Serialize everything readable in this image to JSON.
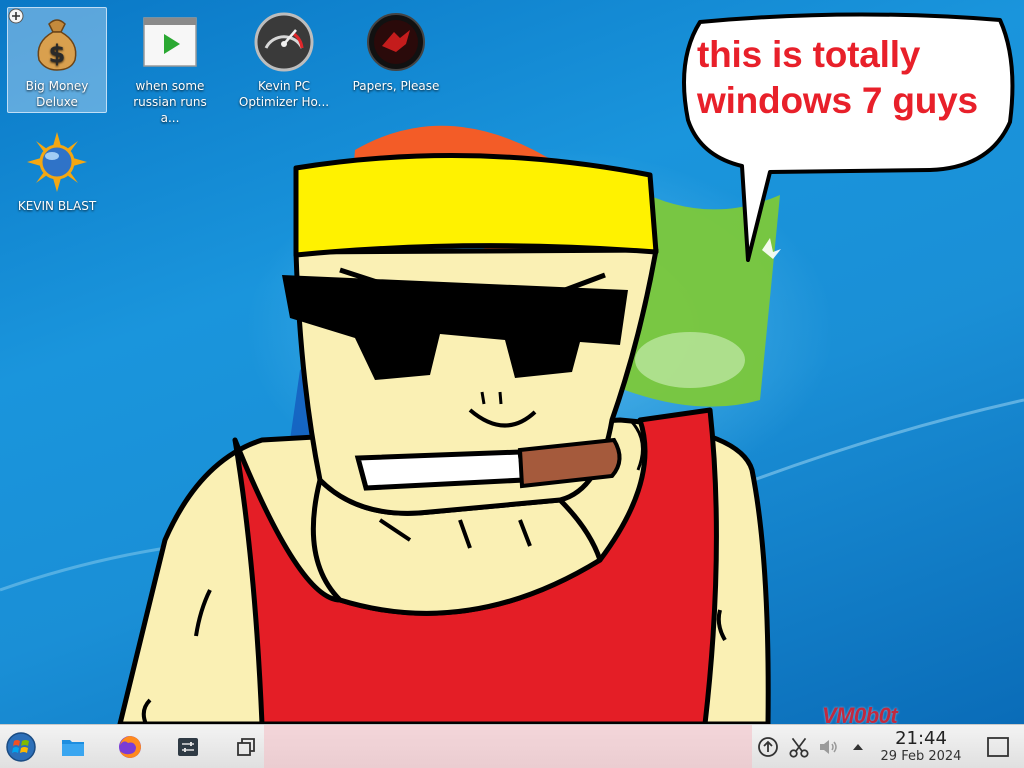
{
  "desktop": {
    "icons": [
      {
        "label": "Big Money Deluxe",
        "icon": "money-bag-icon"
      },
      {
        "label": "when some russian runs a...",
        "icon": "video-player-icon"
      },
      {
        "label": "Kevin PC Optimizer Ho...",
        "icon": "speedometer-icon"
      },
      {
        "label": "Papers, Please",
        "icon": "papers-please-icon"
      },
      {
        "label": "KEVIN BLAST",
        "icon": "sun-globe-icon"
      }
    ],
    "speech_bubble": {
      "line1": "this is totally",
      "line2": "windows 7 guys"
    },
    "watermark": "VM0b0t"
  },
  "taskbar": {
    "launchers": [
      "start-menu-icon",
      "file-manager-icon",
      "firefox-icon",
      "system-settings-icon",
      "window-switcher-icon"
    ],
    "tray": [
      "updates-icon",
      "clipboard-scissors-icon",
      "volume-icon",
      "tray-expand-icon"
    ],
    "clock": {
      "time": "21:44",
      "date": "29 Feb 2024"
    }
  },
  "colors": {
    "desktop_blue": "#1a8fd6",
    "speech_red": "#e8202a",
    "tank_top_red": "#e41e26",
    "headband_yellow": "#fff200",
    "skin": "#faf0b4",
    "taskbar": "#ebebeb"
  }
}
